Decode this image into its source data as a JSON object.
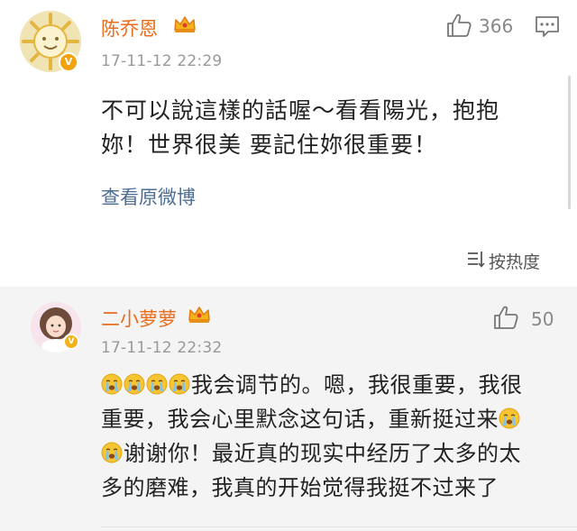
{
  "post": {
    "username": "陈乔恩",
    "timestamp": "17-11-12 22:29",
    "like_count": "366",
    "text_line1": "不可以說這樣的話喔～看看陽光，抱抱",
    "text_line2": "妳！世界很美 要記住妳很重要！",
    "view_original": "查看原微博",
    "verified_badge": "V"
  },
  "sort": {
    "label": "按热度"
  },
  "reply": {
    "username": "二小萝萝",
    "timestamp": "17-11-12 22:32",
    "like_count": "50",
    "line1_text": "我会调节的。嗯，我很重要，我很",
    "line2_text": "重要，我会心里默念这句话，重新挺过来",
    "line3_text": "谢谢你！最近真的现实中经历了太多的太",
    "line4_text": "多的磨难，我真的开始觉得我挺不过来了",
    "verified_badge": "V"
  },
  "icons": {
    "crown": "crown-icon",
    "like": "thumbs-up-icon",
    "comment": "comment-icon",
    "sort": "sort-icon",
    "emoji": "crying-face-emoji"
  },
  "colors": {
    "username": "#e96d1d",
    "link": "#4e6d93",
    "timestamp": "#999999",
    "reply_background": "#f4f4f4",
    "verified_badge": "#f2a20c"
  }
}
